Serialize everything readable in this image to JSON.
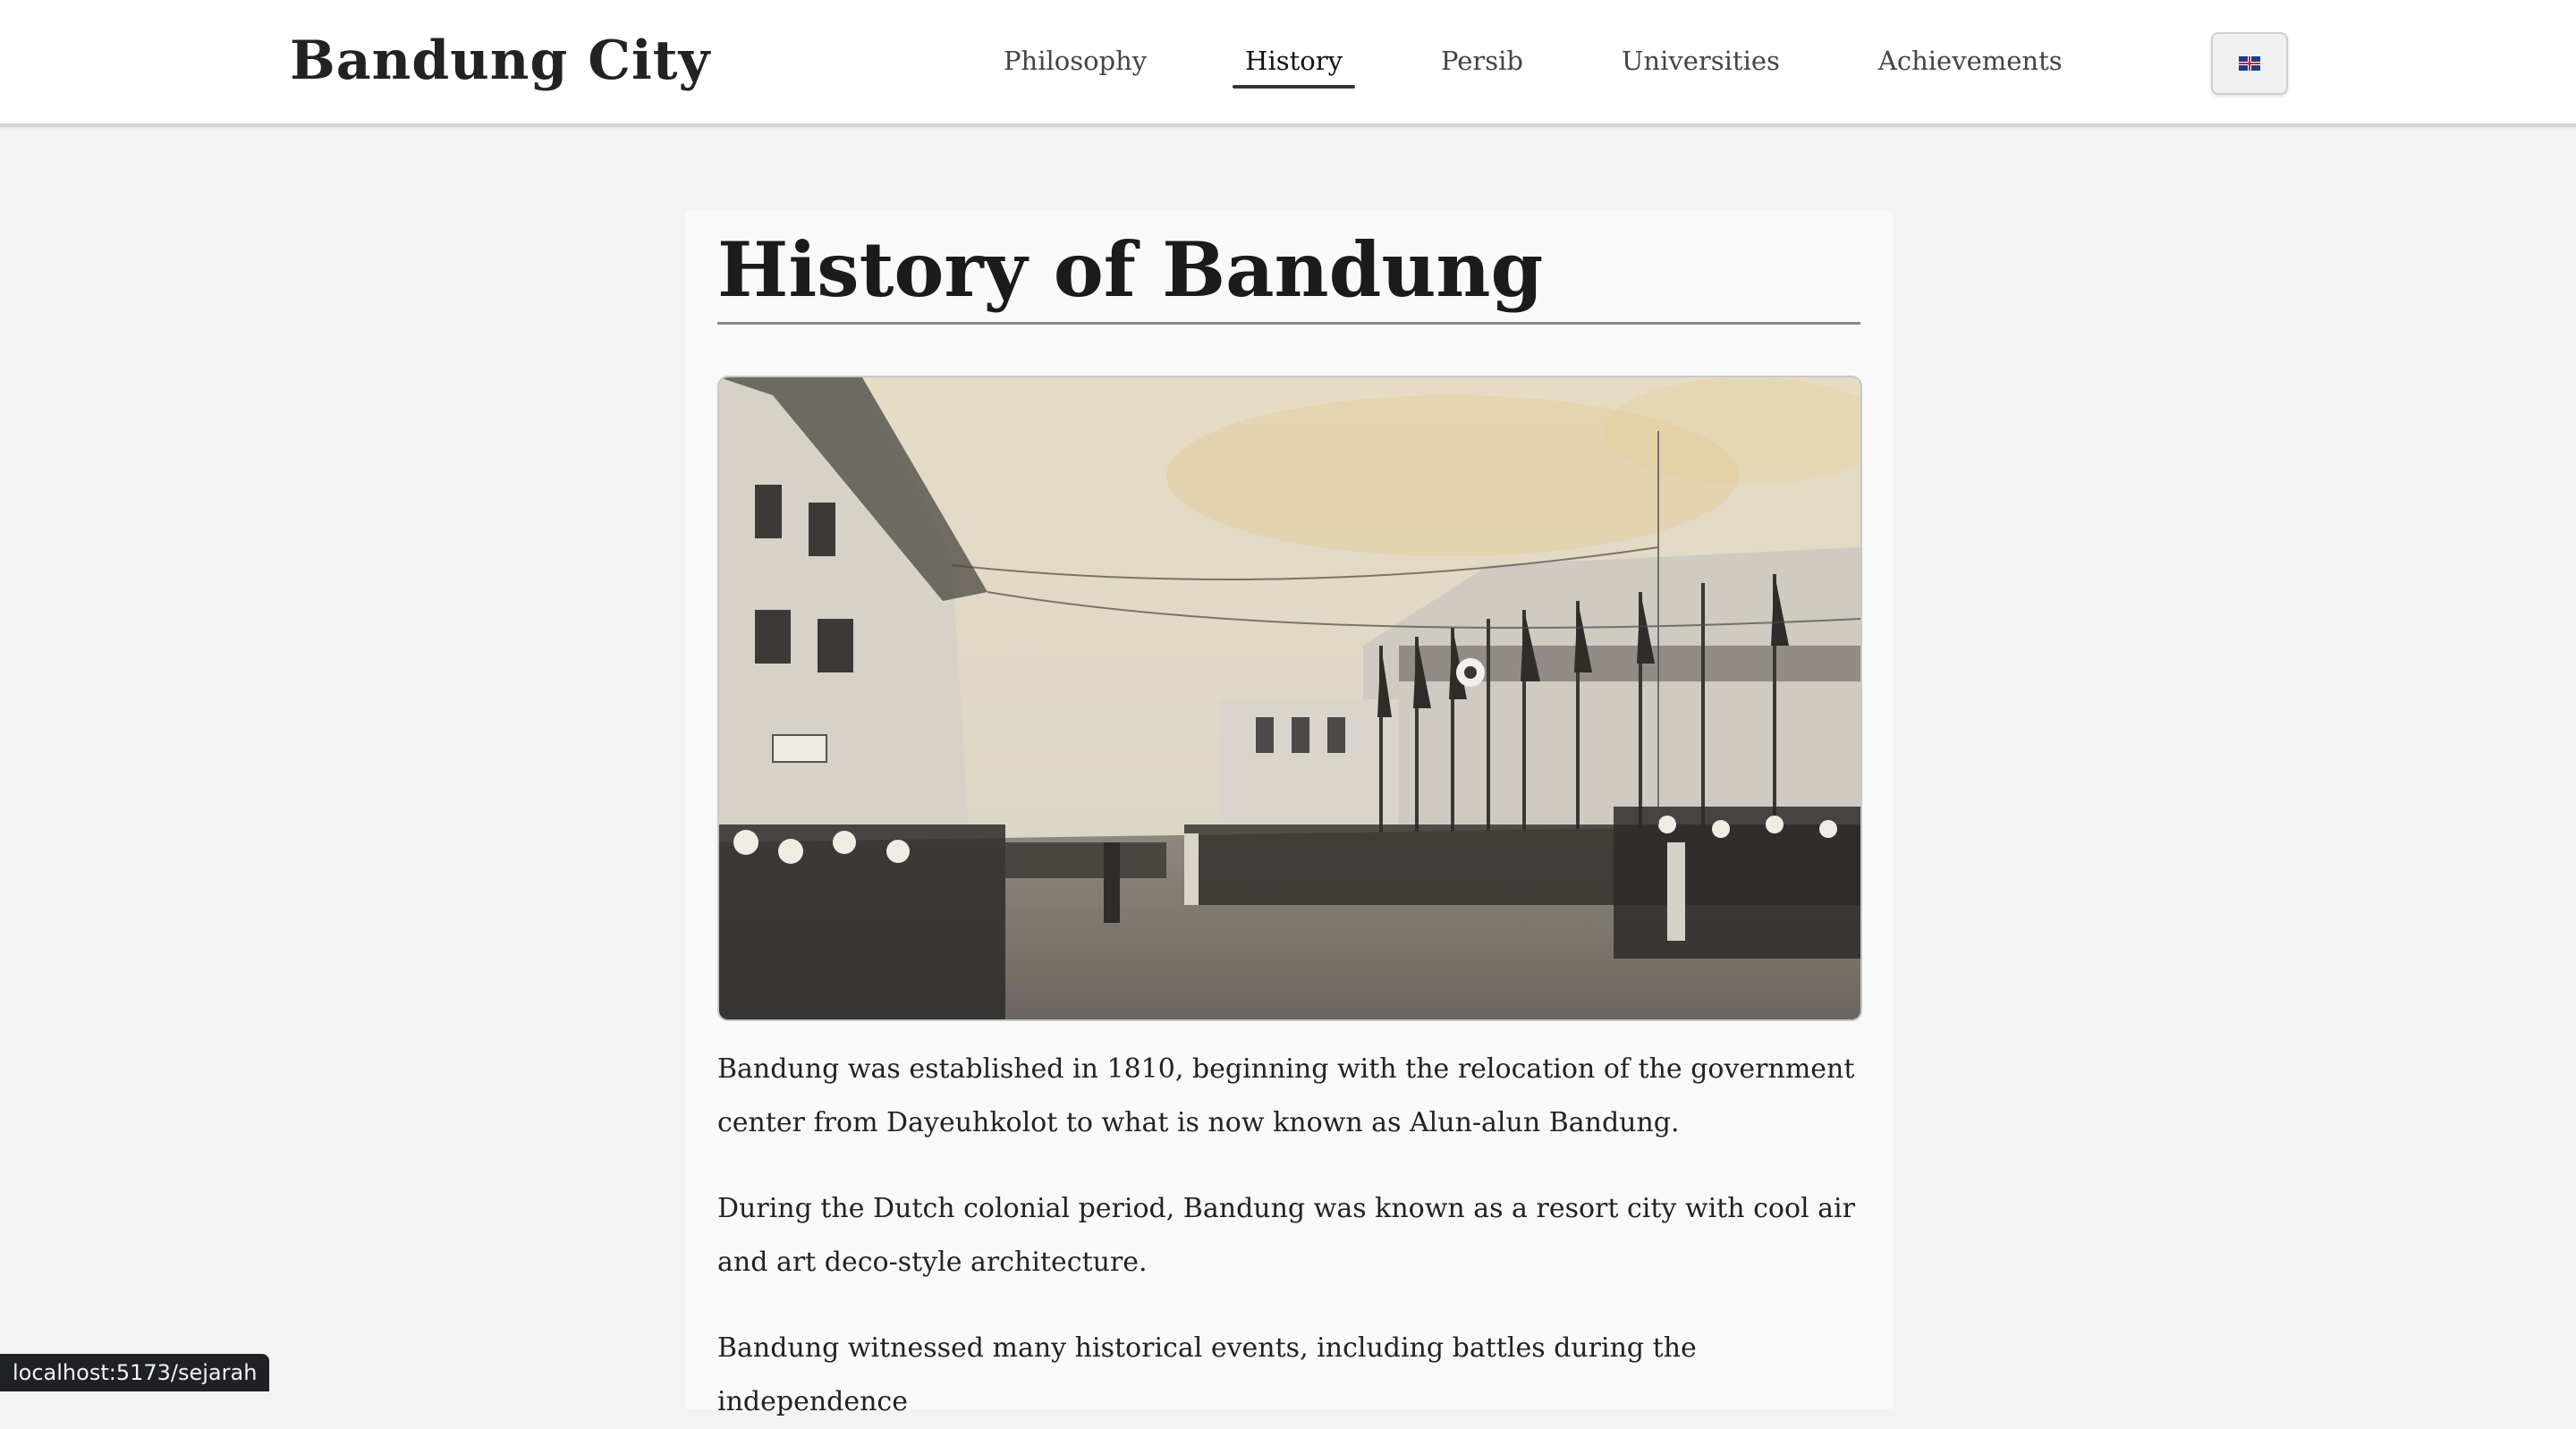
{
  "header": {
    "brand": "Bandung City",
    "nav": [
      {
        "label": "Philosophy",
        "active": false
      },
      {
        "label": "History",
        "active": true
      },
      {
        "label": "Persib",
        "active": false
      },
      {
        "label": "Universities",
        "active": false
      },
      {
        "label": "Achievements",
        "active": false
      }
    ],
    "language_icon": "uk-flag-icon"
  },
  "main": {
    "title": "History of Bandung",
    "image_subject": "historic-street-photo",
    "paragraphs": [
      "Bandung was established in 1810, beginning with the relocation of the government center from Dayeuhkolot to what is now known as Alun-alun Bandung.",
      "During the Dutch colonial period, Bandung was known as a resort city with cool air and art deco-style architecture.",
      "Bandung witnessed many historical events, including battles during the independence"
    ]
  },
  "status_bar": {
    "url": "localhost:5173/sejarah"
  },
  "colors": {
    "header_bg": "#ffffff",
    "page_bg": "#f3f3f3",
    "content_bg": "#f9f9f9",
    "text": "#222222",
    "status_bg": "#1f2124"
  }
}
